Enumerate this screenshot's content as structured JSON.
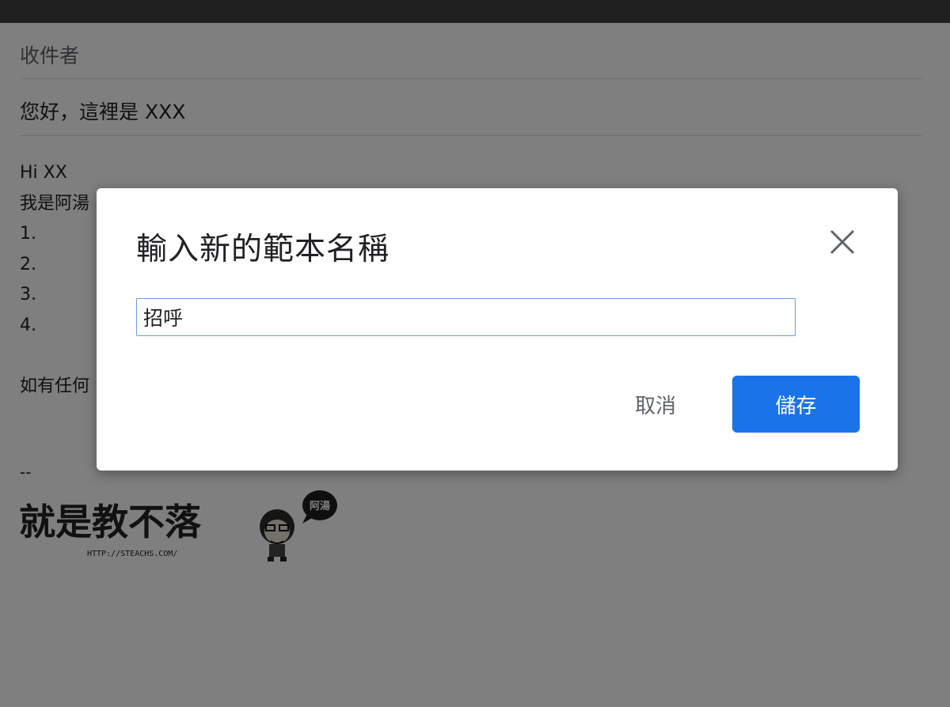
{
  "compose": {
    "recipients_label": "收件者",
    "subject": "您好，這裡是 XXX",
    "body_lines": [
      "Hi XX",
      "我是阿湯",
      "1.",
      "2.",
      "3.",
      "4.",
      "",
      "如有任何"
    ],
    "signature_separator": "--",
    "signature_logo_text": "就是教不落",
    "signature_logo_badge": "阿湯",
    "signature_url": "HTTP://STEACHS.COM/"
  },
  "dialog": {
    "title": "輸入新的範本名稱",
    "close_icon": "close-icon",
    "input_value": "招呼",
    "cancel_label": "取消",
    "save_label": "儲存"
  },
  "colors": {
    "primary": "#1a73e8",
    "input_border": "#6c9ae4",
    "overlay": "rgba(0,0,0,0.5)"
  }
}
